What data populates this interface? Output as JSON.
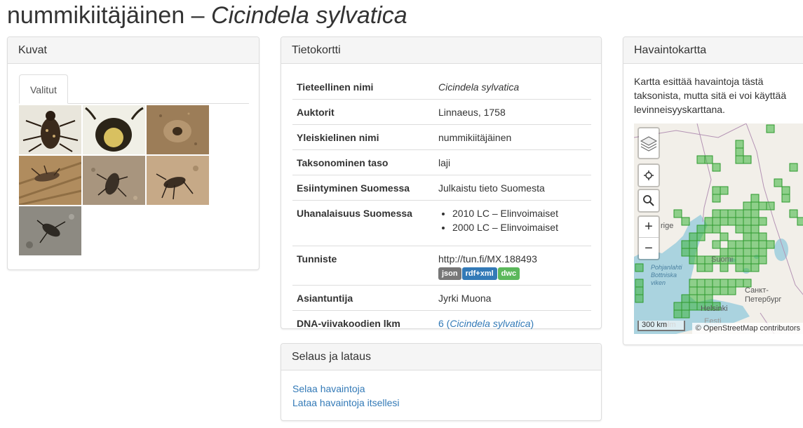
{
  "page": {
    "title_common": "nummikiitäjäinen – ",
    "title_scientific": "Cicindela sylvatica"
  },
  "images_panel": {
    "heading": "Kuvat",
    "tab_label": "Valitut",
    "thumb_count": 7
  },
  "info_panel": {
    "heading": "Tietokortti",
    "rows": {
      "scientific_name": {
        "key": "Tieteellinen nimi",
        "value": "Cicindela sylvatica"
      },
      "authors": {
        "key": "Auktorit",
        "value": "Linnaeus, 1758"
      },
      "common_name": {
        "key": "Yleiskielinen nimi",
        "value": "nummikiitäjäinen"
      },
      "rank": {
        "key": "Taksonominen taso",
        "value": "laji"
      },
      "occurrence": {
        "key": "Esiintyminen Suomessa",
        "value": "Julkaistu tieto Suomesta"
      },
      "threat": {
        "key": "Uhanalaisuus Suomessa",
        "values": [
          "2010 LC – Elinvoimaiset",
          "2000 LC – Elinvoimaiset"
        ]
      },
      "identifier": {
        "key": "Tunniste",
        "value": "http://tun.fi/MX.188493",
        "badges": [
          "json",
          "rdf+xml",
          "dwc"
        ]
      },
      "expert": {
        "key": "Asiantuntija",
        "value": "Jyrki Muona"
      },
      "dna": {
        "key": "DNA-viivakoodien lkm",
        "count": "6",
        "open": " (",
        "name": "Cicindela sylvatica",
        "close": ")"
      }
    }
  },
  "browse_panel": {
    "heading": "Selaus ja lataus",
    "links": [
      "Selaa havaintoja",
      "Lataa havaintoja itsellesi"
    ]
  },
  "map_panel": {
    "heading": "Havaintokartta",
    "description": "Kartta esittää havaintoja tästä taksonista, mutta sitä ei voi käyttää levinneisyyskarttana.",
    "attribution": "© OpenStreetMap contributors",
    "scale": "300 km",
    "labels": {
      "suomi": "Suomi",
      "sverige_frag": "rige",
      "helsinki": "Helsinki",
      "spb": "Санкт-Петербург",
      "gulf": "Pohjanlahti Bottniska viken",
      "eesti": "Eesti",
      "holm": "olm"
    },
    "controls": {
      "layers": "layers-icon",
      "locate": "crosshair-icon",
      "search": "search-icon",
      "zoom_in": "+",
      "zoom_out": "−"
    }
  }
}
